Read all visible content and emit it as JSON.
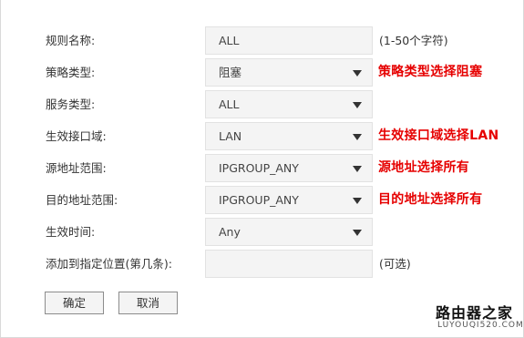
{
  "rows": [
    {
      "label": "规则名称:",
      "value": "ALL",
      "hint": "(1-50个字符)"
    },
    {
      "label": "策略类型:",
      "value": "阻塞",
      "note": "策略类型选择阻塞"
    },
    {
      "label": "服务类型:",
      "value": "ALL"
    },
    {
      "label": "生效接口域:",
      "value": "LAN",
      "note": "生效接口域选择LAN"
    },
    {
      "label": "源地址范围:",
      "value": "IPGROUP_ANY",
      "note": "源地址选择所有"
    },
    {
      "label": "目的地址范围:",
      "value": "IPGROUP_ANY",
      "note": "目的地址选择所有"
    },
    {
      "label": "生效时间:",
      "value": "Any"
    },
    {
      "label": "添加到指定位置(第几条):",
      "value": "",
      "hint": "(可选)"
    }
  ],
  "buttons": {
    "confirm": "确定",
    "cancel": "取消"
  },
  "watermark": {
    "main": "路由器之家",
    "sub": "LUYOUQI520.COM"
  },
  "colors": {
    "annotation": "#e60000"
  }
}
